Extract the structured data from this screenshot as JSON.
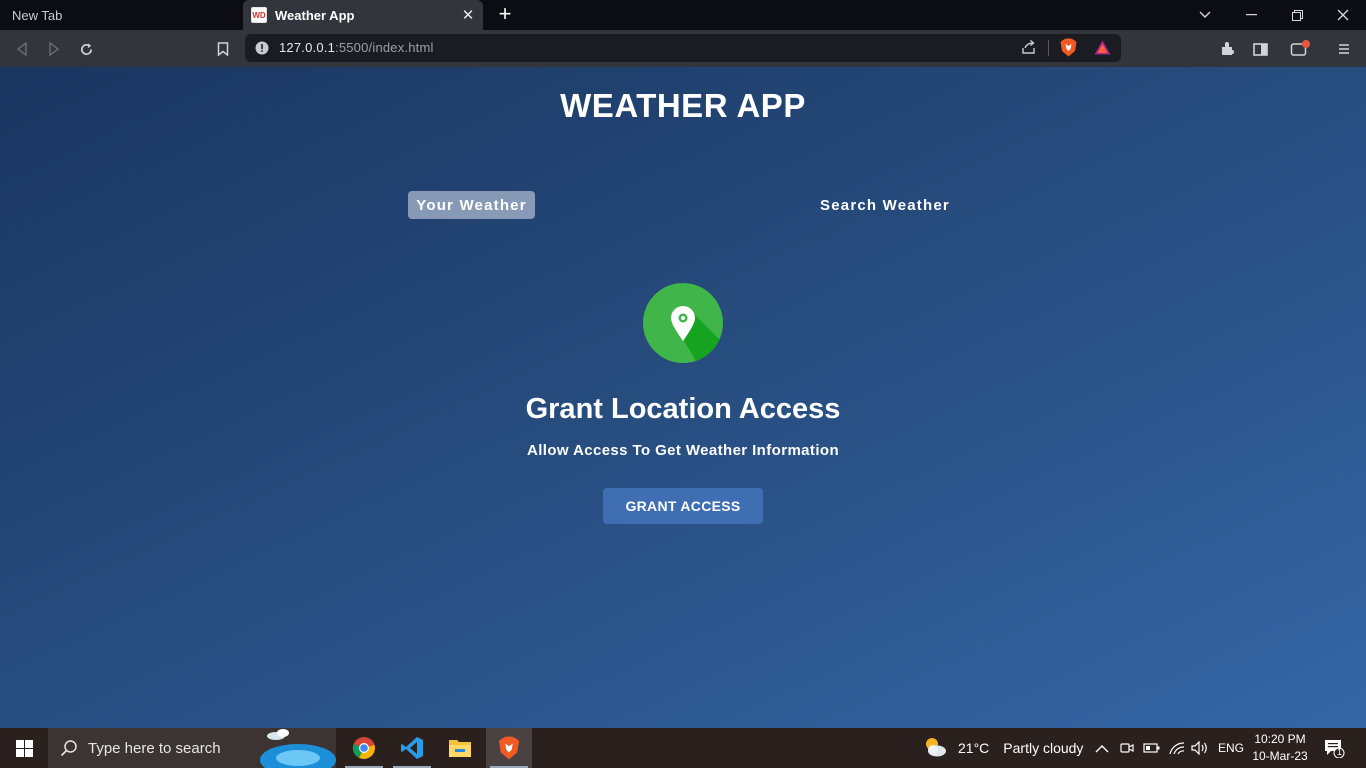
{
  "browser": {
    "tabs": [
      {
        "title": "New Tab",
        "active": false
      },
      {
        "title": "Weather App",
        "active": true,
        "favicon_text": "WD"
      }
    ],
    "url_host": "127.0.0.1",
    "url_rest": ":5500/index.html"
  },
  "page": {
    "app_title": "WEATHER APP",
    "tab_your_weather": "Your Weather",
    "tab_search_weather": "Search Weather",
    "grant_title": "Grant Location Access",
    "grant_subtitle": "Allow Access To Get Weather Information",
    "grant_button": "GRANT ACCESS",
    "colors": {
      "bg_start": "#1a3560",
      "bg_end": "#3566a6",
      "button": "#3f6fb2",
      "icon_green": "#3fb54a"
    }
  },
  "taskbar": {
    "search_placeholder": "Type here to search",
    "weather_temp": "21°C",
    "weather_desc": "Partly cloudy",
    "language": "ENG",
    "time": "10:20 PM",
    "date": "10-Mar-23",
    "notification_count": "1"
  }
}
